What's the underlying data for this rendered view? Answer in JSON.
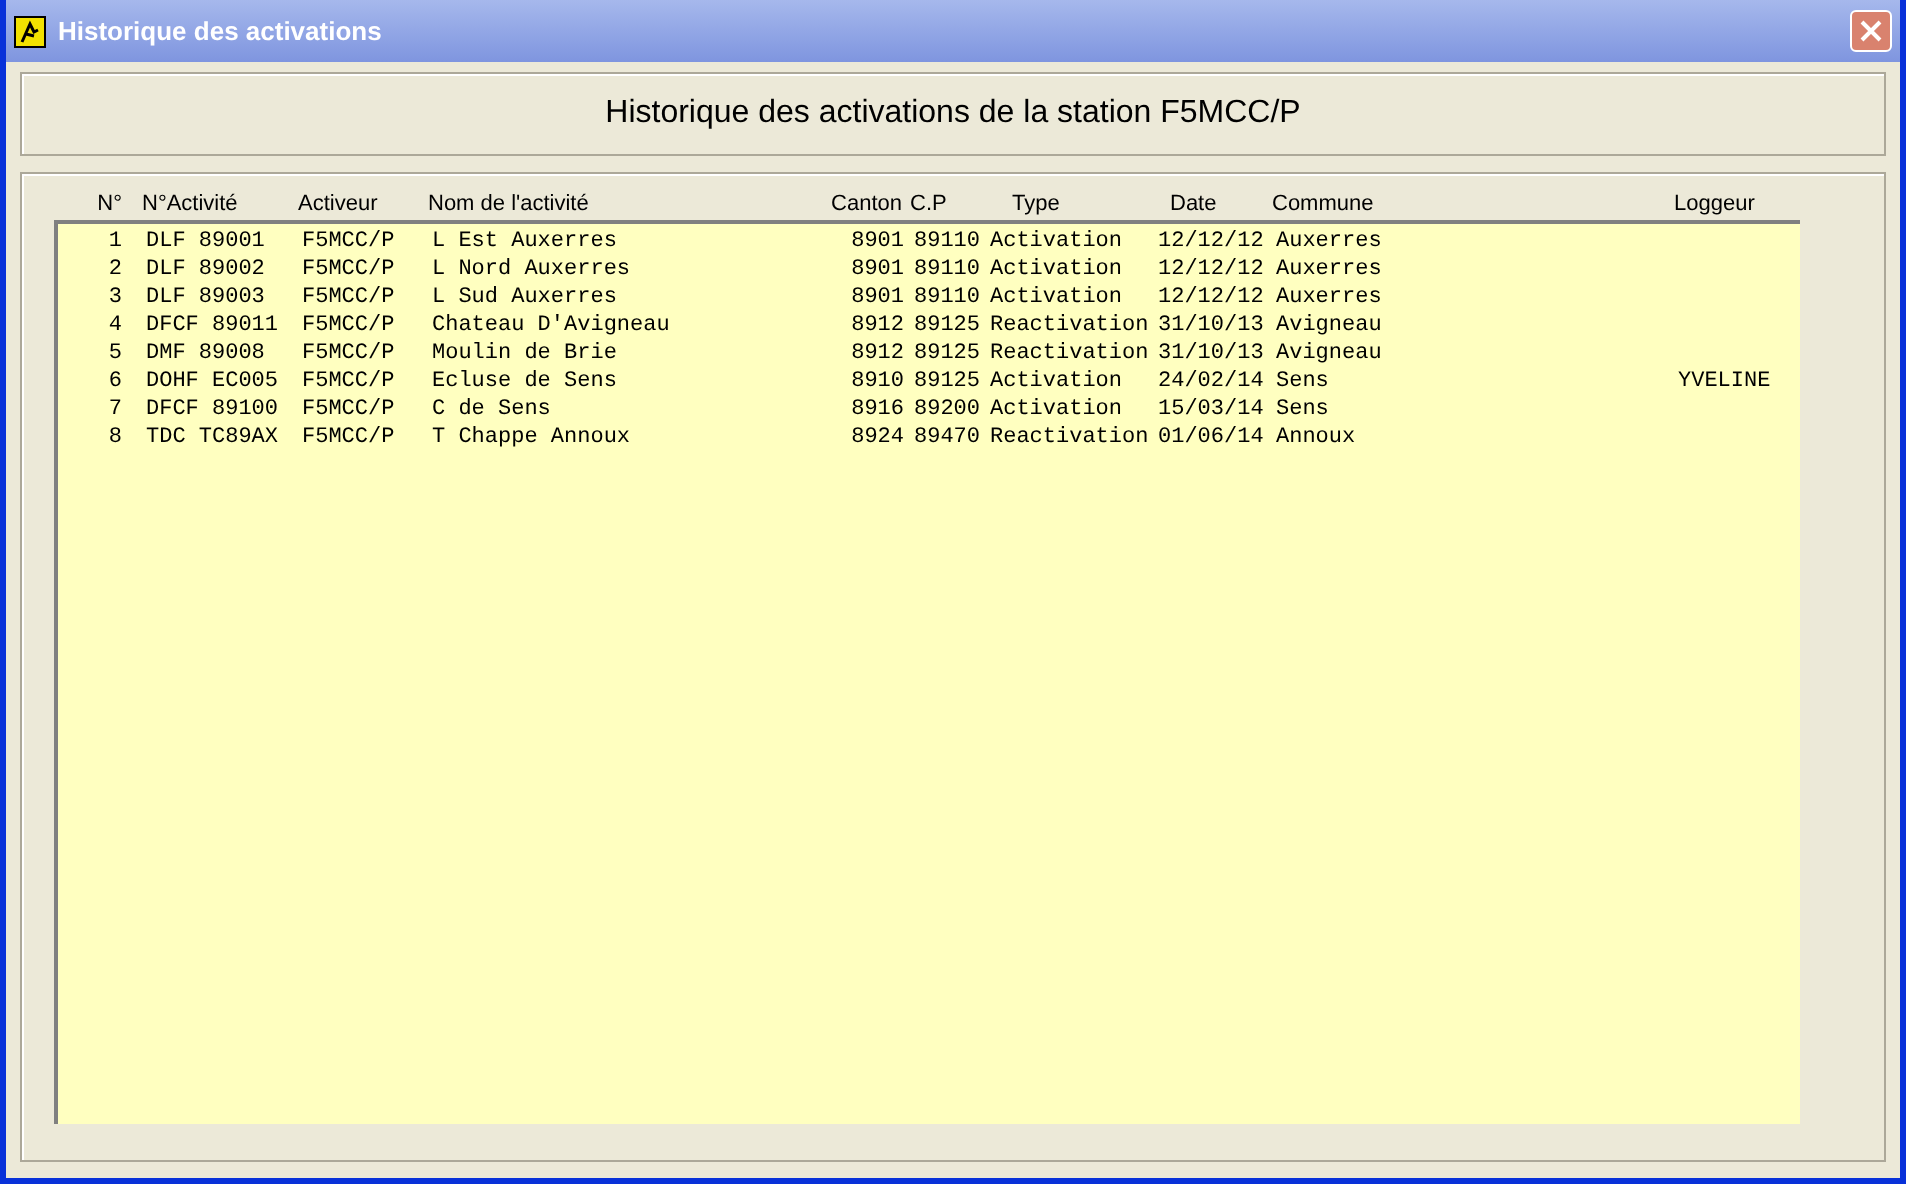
{
  "window": {
    "title": "Historique des activations"
  },
  "heading": "Historique des activations de la station F5MCC/P",
  "table": {
    "columns": [
      "N°",
      "N°Activité",
      "Activeur",
      "Nom de l'activité",
      "Canton",
      "C.P",
      "Type",
      "Date",
      "Commune",
      "Loggeur"
    ],
    "rows": [
      [
        "1",
        "DLF 89001",
        "F5MCC/P",
        "L Est Auxerres",
        "8901",
        "89110",
        "Activation",
        "12/12/12",
        "Auxerres",
        ""
      ],
      [
        "2",
        "DLF 89002",
        "F5MCC/P",
        "L Nord Auxerres",
        "8901",
        "89110",
        "Activation",
        "12/12/12",
        "Auxerres",
        ""
      ],
      [
        "3",
        "DLF 89003",
        "F5MCC/P",
        "L Sud Auxerres",
        "8901",
        "89110",
        "Activation",
        "12/12/12",
        "Auxerres",
        ""
      ],
      [
        "4",
        "DFCF 89011",
        "F5MCC/P",
        "Chateau D'Avigneau",
        "8912",
        "89125",
        "Reactivation",
        "31/10/13",
        "Avigneau",
        ""
      ],
      [
        "5",
        "DMF 89008",
        "F5MCC/P",
        "Moulin de Brie",
        "8912",
        "89125",
        "Reactivation",
        "31/10/13",
        "Avigneau",
        ""
      ],
      [
        "6",
        "DOHF EC005",
        "F5MCC/P",
        "Ecluse de Sens",
        "8910",
        "89125",
        "Activation",
        "24/02/14",
        "Sens",
        "YVELINE"
      ],
      [
        "7",
        "DFCF 89100",
        "F5MCC/P",
        "C de Sens",
        "8916",
        "89200",
        "Activation",
        "15/03/14",
        "Sens",
        ""
      ],
      [
        "8",
        "TDC TC89AX",
        "F5MCC/P",
        "T Chappe Annoux",
        "8924",
        "89470",
        "Reactivation",
        "01/06/14",
        "Annoux",
        ""
      ]
    ]
  }
}
